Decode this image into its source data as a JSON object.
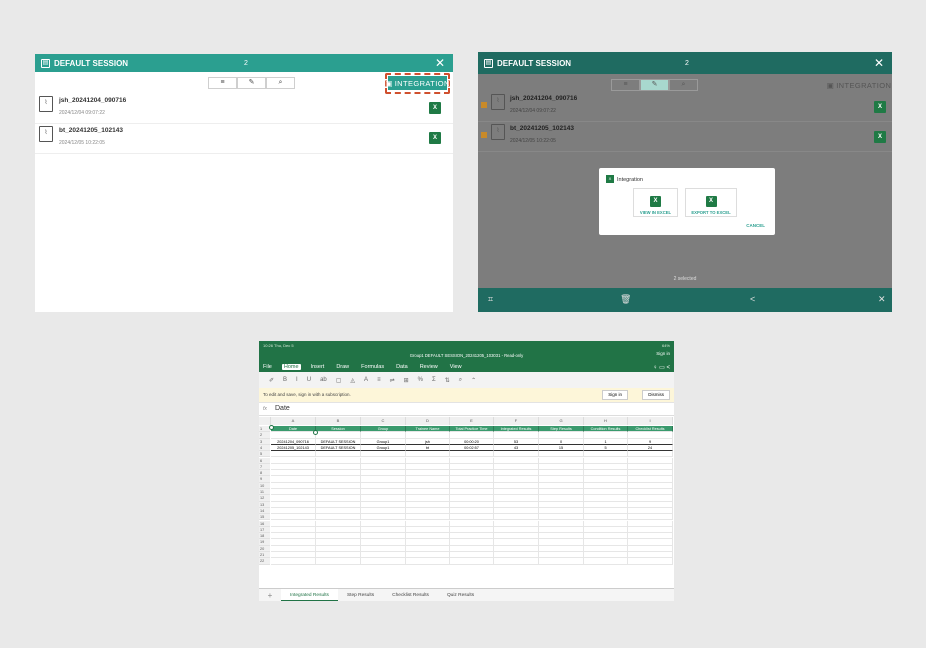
{
  "panel1": {
    "title": "DEFAULT SESSION",
    "count": "2",
    "integration_label": "INTEGRATION",
    "files": [
      {
        "name": "jsh_20241204_090716",
        "date": "2024/12/04 09:07:22"
      },
      {
        "name": "bt_20241205_102143",
        "date": "2024/12/05 10:22:05"
      }
    ]
  },
  "panel2": {
    "title": "DEFAULT SESSION",
    "count": "2",
    "integration_label": "INTEGRATION",
    "files": [
      {
        "name": "jsh_20241204_090716",
        "date": "2024/12/04 09:07:22"
      },
      {
        "name": "bt_20241205_102143",
        "date": "2024/12/05 10:22:05"
      }
    ],
    "dialog": {
      "title": "Integration",
      "view_label": "VIEW IN EXCEL",
      "export_label": "EXPORT TO EXCEL",
      "cancel_label": "CANCEL"
    },
    "selected_text": "2 selected"
  },
  "excel": {
    "status_left": "10:26  Thu, Dec 5",
    "status_right": "64%",
    "doc_title": "Group1 DEFAULT SESSION_20241205_103031 - Read-only",
    "sign_in_top": "Sign in",
    "menu": [
      "File",
      "Home",
      "Insert",
      "Draw",
      "Formulas",
      "Data",
      "Review",
      "View"
    ],
    "message": "To edit and save, sign in with a subscription.",
    "sign_in_btn": "Sign in",
    "dismiss_btn": "Dismiss",
    "fx": "fx",
    "formula_value": "Date",
    "columns": [
      "A",
      "B",
      "C",
      "D",
      "E",
      "F",
      "G",
      "H",
      "I"
    ],
    "headers": [
      "Date",
      "Session",
      "Group",
      "Trainee Name",
      "Total Practice Time",
      "Integrated Results",
      "Step Results",
      "Condition Results",
      "Checklist Results"
    ],
    "rows": [
      [
        "20241204_090716",
        "DEFAULT SESSION",
        "Group1",
        "jsh",
        "00:00:20",
        "53",
        "0",
        "1",
        "9"
      ],
      [
        "20241205_102143",
        "DEFAULT SESSION",
        "Group1",
        "bt",
        "00:02:57",
        "43",
        "15",
        "5",
        "24"
      ]
    ],
    "row_numbers": [
      "1",
      "2",
      "3",
      "4",
      "5",
      "6",
      "7",
      "8",
      "9",
      "10",
      "11",
      "12",
      "13",
      "14",
      "15",
      "16",
      "17",
      "18",
      "19",
      "20",
      "21",
      "22"
    ],
    "sheet_tabs": [
      "Integrated Results",
      "Step Results",
      "Checklist Results",
      "Quiz Results"
    ]
  }
}
